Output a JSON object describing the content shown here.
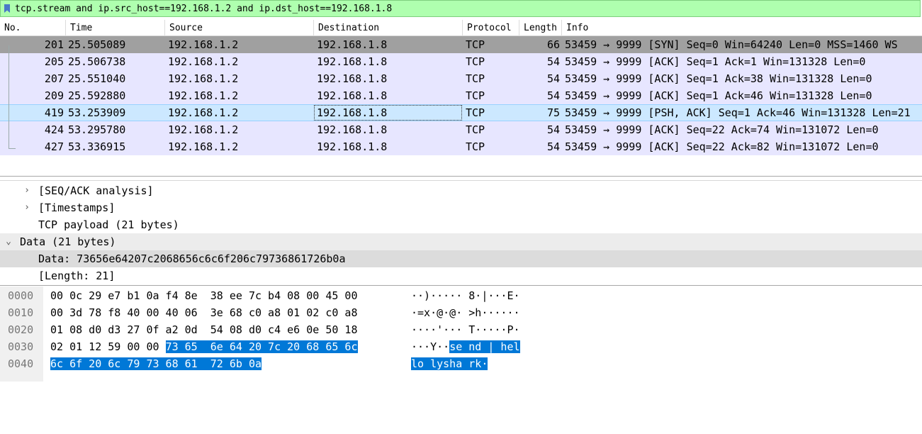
{
  "filter": {
    "text": "tcp.stream and ip.src_host==192.168.1.2 and ip.dst_host==192.168.1.8"
  },
  "columns": [
    "No.",
    "Time",
    "Source",
    "Destination",
    "Protocol",
    "Length",
    "Info"
  ],
  "packets": [
    {
      "no": "201",
      "time": "25.505089",
      "src": "192.168.1.2",
      "dst": "192.168.1.8",
      "proto": "TCP",
      "len": "66",
      "info": "53459 → 9999 [SYN] Seq=0 Win=64240 Len=0 MSS=1460 WS"
    },
    {
      "no": "205",
      "time": "25.506738",
      "src": "192.168.1.2",
      "dst": "192.168.1.8",
      "proto": "TCP",
      "len": "54",
      "info": "53459 → 9999 [ACK] Seq=1 Ack=1 Win=131328 Len=0"
    },
    {
      "no": "207",
      "time": "25.551040",
      "src": "192.168.1.2",
      "dst": "192.168.1.8",
      "proto": "TCP",
      "len": "54",
      "info": "53459 → 9999 [ACK] Seq=1 Ack=38 Win=131328 Len=0"
    },
    {
      "no": "209",
      "time": "25.592880",
      "src": "192.168.1.2",
      "dst": "192.168.1.8",
      "proto": "TCP",
      "len": "54",
      "info": "53459 → 9999 [ACK] Seq=1 Ack=46 Win=131328 Len=0"
    },
    {
      "no": "419",
      "time": "53.253909",
      "src": "192.168.1.2",
      "dst": "192.168.1.8",
      "proto": "TCP",
      "len": "75",
      "info": "53459 → 9999 [PSH, ACK] Seq=1 Ack=46 Win=131328 Len=21"
    },
    {
      "no": "424",
      "time": "53.295780",
      "src": "192.168.1.2",
      "dst": "192.168.1.8",
      "proto": "TCP",
      "len": "54",
      "info": "53459 → 9999 [ACK] Seq=22 Ack=74 Win=131072 Len=0"
    },
    {
      "no": "427",
      "time": "53.336915",
      "src": "192.168.1.2",
      "dst": "192.168.1.8",
      "proto": "TCP",
      "len": "54",
      "info": "53459 → 9999 [ACK] Seq=22 Ack=82 Win=131072 Len=0"
    }
  ],
  "details": [
    {
      "label": "[SEQ/ACK analysis]",
      "arrow": "›"
    },
    {
      "label": "[Timestamps]",
      "arrow": "›"
    },
    {
      "label": "TCP payload (21 bytes)",
      "arrow": ""
    },
    {
      "label": "Data (21 bytes)",
      "arrow": "⌄"
    },
    {
      "label": "Data: 73656e64207c2068656c6c6f206c79736861726b0a",
      "arrow": ""
    },
    {
      "label": "[Length: 21]",
      "arrow": ""
    }
  ],
  "bytes": [
    {
      "offset": "0000",
      "hex_plain": "00 0c 29 e7 b1 0a f4 8e  38 ee 7c b4 08 00 45 00",
      "hex_sel": "",
      "ascii_plain": "··)····· 8·|···E·",
      "ascii_sel": ""
    },
    {
      "offset": "0010",
      "hex_plain": "00 3d 78 f8 40 00 40 06  3e 68 c0 a8 01 02 c0 a8",
      "hex_sel": "",
      "ascii_plain": "·=x·@·@· >h······",
      "ascii_sel": ""
    },
    {
      "offset": "0020",
      "hex_plain": "01 08 d0 d3 27 0f a2 0d  54 08 d0 c4 e6 0e 50 18",
      "hex_sel": "",
      "ascii_plain": "····'··· T·····P·",
      "ascii_sel": ""
    },
    {
      "offset": "0030",
      "hex_plain": "02 01 12 59 00 00 ",
      "hex_sel": "73 65  6e 64 20 7c 20 68 65 6c",
      "ascii_plain": "···Y··",
      "ascii_sel": "se nd | hel"
    },
    {
      "offset": "0040",
      "hex_plain": "",
      "hex_sel": "6c 6f 20 6c 79 73 68 61  72 6b 0a",
      "ascii_plain": "",
      "ascii_sel": "lo lysha rk·"
    }
  ]
}
